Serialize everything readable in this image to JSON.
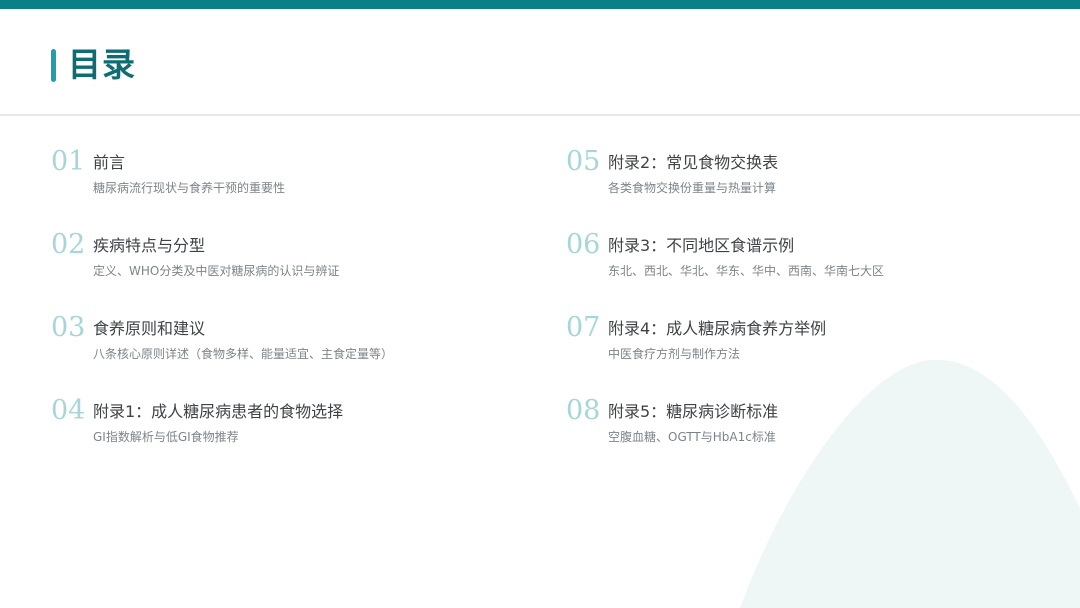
{
  "theme": {
    "primary": "#0b7f86",
    "accent_bar": "#1aa0b0",
    "title_color": "#0e6d73",
    "number_color": "#a7d6d9",
    "bg_shape_color": "#eef7f6"
  },
  "header": {
    "title": "目录"
  },
  "toc": {
    "items": [
      {
        "num": "01",
        "title": "前言",
        "subtitle": "糖尿病流行现状与食养干预的重要性"
      },
      {
        "num": "02",
        "title": "疾病特点与分型",
        "subtitle": "定义、WHO分类及中医对糖尿病的认识与辨证"
      },
      {
        "num": "03",
        "title": "食养原则和建议",
        "subtitle": "八条核心原则详述（食物多样、能量适宜、主食定量等）"
      },
      {
        "num": "04",
        "title": "附录1：成人糖尿病患者的食物选择",
        "subtitle": "GI指数解析与低GI食物推荐"
      },
      {
        "num": "05",
        "title": "附录2：常见食物交换表",
        "subtitle": "各类食物交换份重量与热量计算"
      },
      {
        "num": "06",
        "title": "附录3：不同地区食谱示例",
        "subtitle": "东北、西北、华北、华东、华中、西南、华南七大区"
      },
      {
        "num": "07",
        "title": "附录4：成人糖尿病食养方举例",
        "subtitle": "中医食疗方剂与制作方法"
      },
      {
        "num": "08",
        "title": "附录5：糖尿病诊断标准",
        "subtitle": "空腹血糖、OGTT与HbA1c标准"
      }
    ]
  }
}
